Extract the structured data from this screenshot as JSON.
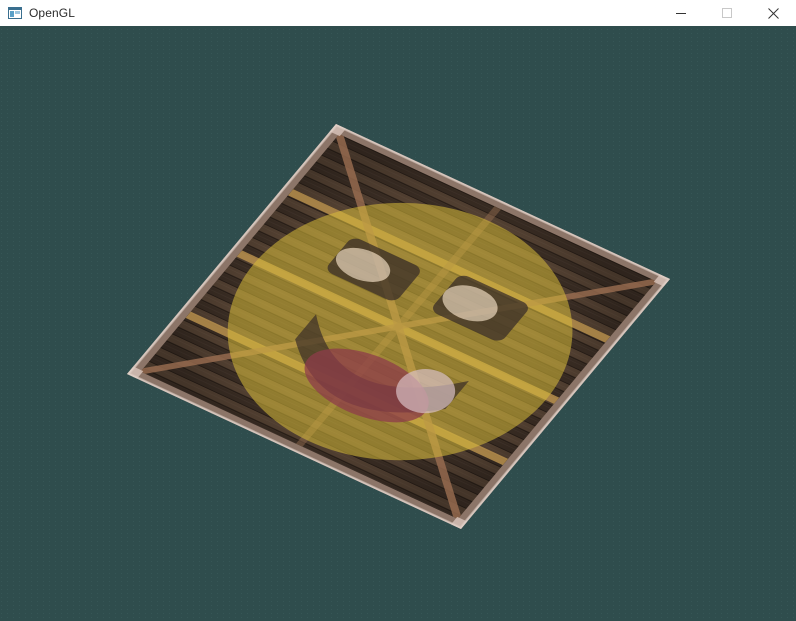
{
  "window": {
    "title": "OpenGL",
    "app_icon": "opengl-window-icon",
    "controls": {
      "minimize_icon": "minimize-icon",
      "maximize_icon": "maximize-icon",
      "close_icon": "close-icon"
    }
  },
  "viewport": {
    "clear_color": "#2f4d4d",
    "scene": "textured-wooden-container-plane-with-blended-face-texture"
  }
}
